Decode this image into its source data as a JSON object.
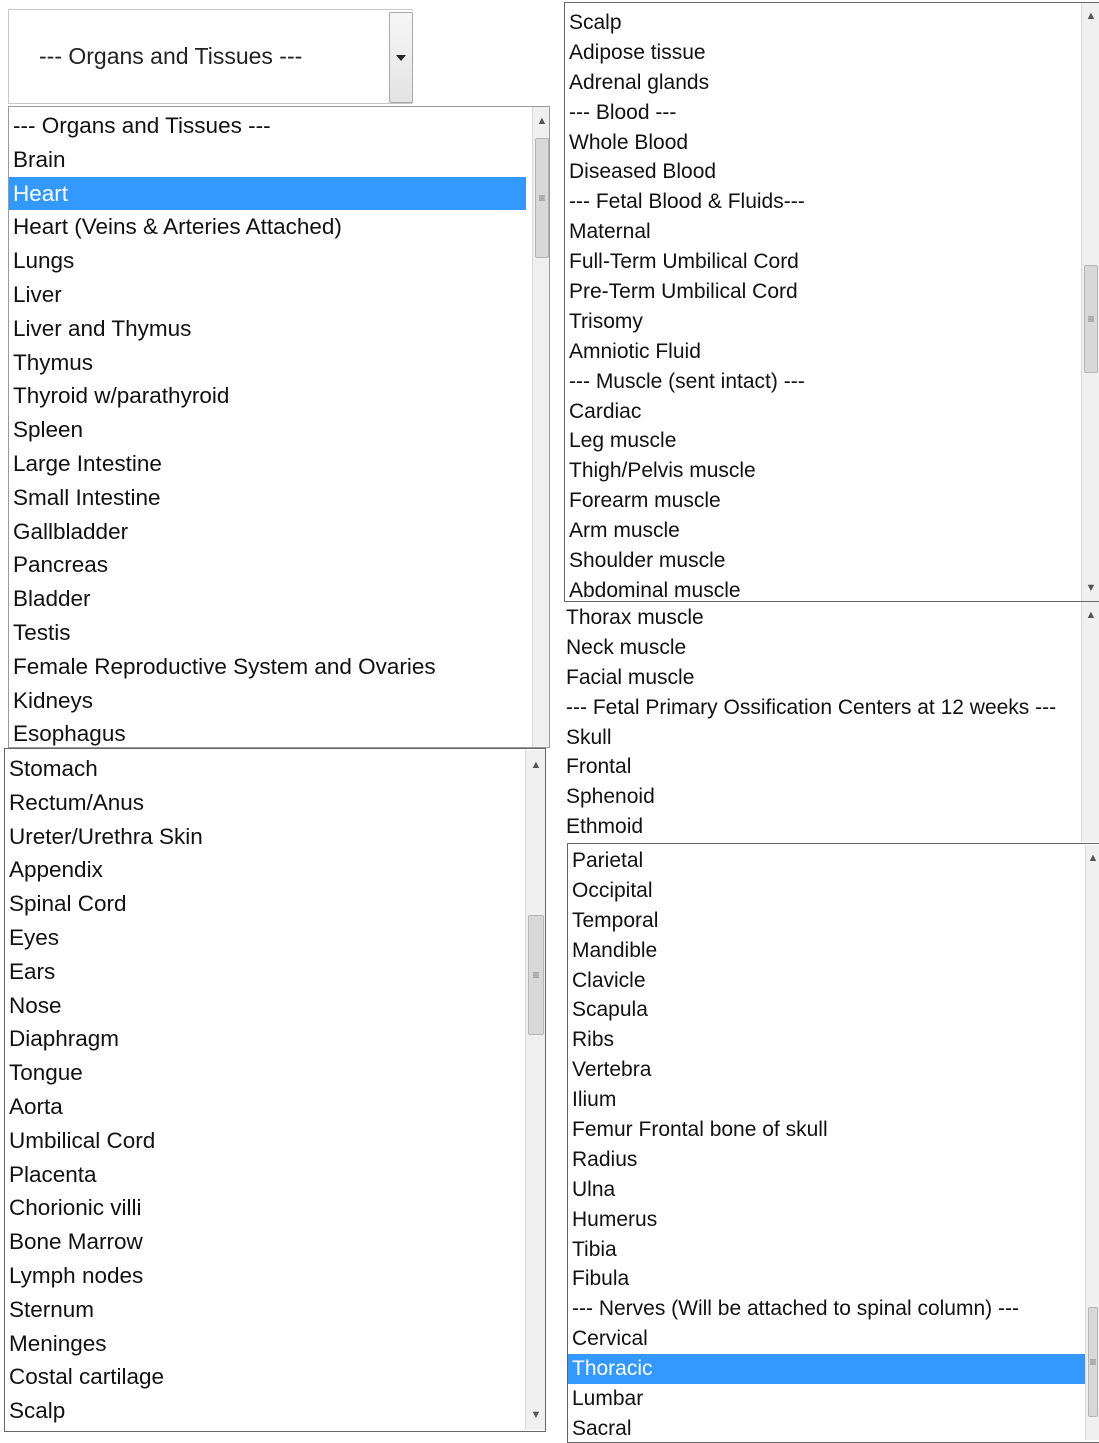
{
  "dropdown": {
    "selected": "--- Organs and Tissues ---"
  },
  "list_top_left": [
    {
      "label": "--- Organs and Tissues ---"
    },
    {
      "label": "Brain"
    },
    {
      "label": "Heart",
      "selected": true
    },
    {
      "label": "Heart (Veins & Arteries Attached)"
    },
    {
      "label": "Lungs"
    },
    {
      "label": "Liver"
    },
    {
      "label": "Liver and Thymus"
    },
    {
      "label": "Thymus"
    },
    {
      "label": "Thyroid w/parathyroid"
    },
    {
      "label": "Spleen"
    },
    {
      "label": "Large Intestine"
    },
    {
      "label": "Small Intestine"
    },
    {
      "label": "Gallbladder"
    },
    {
      "label": "Pancreas"
    },
    {
      "label": "Bladder"
    },
    {
      "label": "Testis"
    },
    {
      "label": "Female Reproductive System and Ovaries"
    },
    {
      "label": "Kidneys"
    },
    {
      "label": "Esophagus"
    }
  ],
  "list_bottom_left": [
    {
      "label": "Stomach"
    },
    {
      "label": "Rectum/Anus"
    },
    {
      "label": "Ureter/Urethra Skin"
    },
    {
      "label": "Appendix"
    },
    {
      "label": "Spinal Cord"
    },
    {
      "label": "Eyes"
    },
    {
      "label": "Ears"
    },
    {
      "label": "Nose"
    },
    {
      "label": "Diaphragm"
    },
    {
      "label": "Tongue"
    },
    {
      "label": "Aorta"
    },
    {
      "label": "Umbilical Cord"
    },
    {
      "label": "Placenta"
    },
    {
      "label": "Chorionic villi"
    },
    {
      "label": "Bone Marrow"
    },
    {
      "label": "Lymph nodes"
    },
    {
      "label": "Sternum"
    },
    {
      "label": "Meninges"
    },
    {
      "label": "Costal cartilage"
    },
    {
      "label": "Scalp"
    }
  ],
  "list_top_right": [
    {
      "label": "Scalp"
    },
    {
      "label": "Adipose tissue"
    },
    {
      "label": "Adrenal glands"
    },
    {
      "label": "--- Blood ---"
    },
    {
      "label": "Whole Blood"
    },
    {
      "label": "Diseased Blood"
    },
    {
      "label": "--- Fetal Blood & Fluids---"
    },
    {
      "label": "Maternal"
    },
    {
      "label": "Full-Term Umbilical Cord"
    },
    {
      "label": "Pre-Term Umbilical Cord"
    },
    {
      "label": "Trisomy"
    },
    {
      "label": "Amniotic Fluid"
    },
    {
      "label": "--- Muscle (sent intact) ---"
    },
    {
      "label": "Cardiac"
    },
    {
      "label": "Leg muscle"
    },
    {
      "label": "Thigh/Pelvis muscle"
    },
    {
      "label": "Forearm muscle"
    },
    {
      "label": "Arm muscle"
    },
    {
      "label": "Shoulder muscle"
    },
    {
      "label": "Abdominal muscle"
    }
  ],
  "list_middle_right": [
    {
      "label": "Thorax muscle"
    },
    {
      "label": "Neck muscle"
    },
    {
      "label": "Facial muscle"
    },
    {
      "label": "--- Fetal Primary Ossification Centers at 12 weeks ---"
    },
    {
      "label": "Skull"
    },
    {
      "label": "Frontal"
    },
    {
      "label": "Sphenoid"
    },
    {
      "label": "Ethmoid"
    }
  ],
  "list_bottom_right": [
    {
      "label": "Parietal"
    },
    {
      "label": "Occipital"
    },
    {
      "label": "Temporal"
    },
    {
      "label": "Mandible"
    },
    {
      "label": "Clavicle"
    },
    {
      "label": "Scapula"
    },
    {
      "label": "Ribs"
    },
    {
      "label": "Vertebra"
    },
    {
      "label": "Ilium"
    },
    {
      "label": "Femur Frontal bone of skull"
    },
    {
      "label": "Radius"
    },
    {
      "label": "Ulna"
    },
    {
      "label": "Humerus"
    },
    {
      "label": "Tibia"
    },
    {
      "label": "Fibula"
    },
    {
      "label": "--- Nerves (Will be attached to spinal column) ---"
    },
    {
      "label": "Cervical"
    },
    {
      "label": "Thoracic",
      "selected": true
    },
    {
      "label": "Lumbar"
    },
    {
      "label": "Sacral"
    }
  ],
  "colors": {
    "selection": "#3399ff",
    "selection_text": "#ffffff"
  },
  "icons": {
    "dropdown": "chevron-down-icon",
    "scroll_up": "scroll-up-arrow-icon",
    "scroll_down": "scroll-down-arrow-icon",
    "scroll_grip": "scrollbar-grip-icon"
  }
}
